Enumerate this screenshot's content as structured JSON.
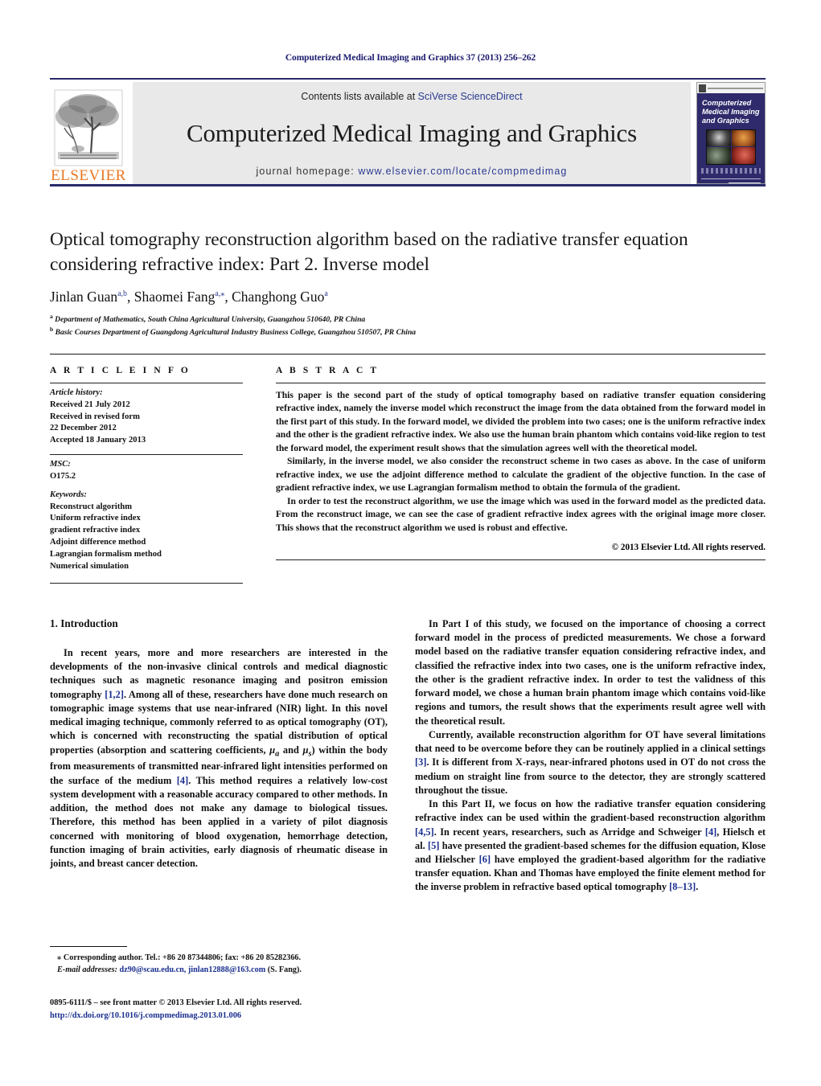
{
  "running_head": "Computerized Medical Imaging and Graphics 37 (2013) 256–262",
  "masthead": {
    "contents_prefix": "Contents lists available at ",
    "contents_link": "SciVerse ScienceDirect",
    "journal_title": "Computerized Medical Imaging and Graphics",
    "homepage_prefix": "journal homepage: ",
    "homepage_url": "www.elsevier.com/locate/compmedimag",
    "publisher": "ELSEVIER",
    "cover_title": "Computerized Medical Imaging and Graphics"
  },
  "article": {
    "title": "Optical tomography reconstruction algorithm based on the radiative transfer equation considering refractive index: Part 2. Inverse model",
    "authors": "Jinlan Guan, Shaomei Fang, Changhong Guo",
    "author_parts": [
      {
        "name": "Jinlan Guan",
        "sup": "a,b",
        "sep": ", "
      },
      {
        "name": "Shaomei Fang",
        "sup": "a,⁎",
        "sep": ", "
      },
      {
        "name": "Changhong Guo",
        "sup": "a",
        "sep": ""
      }
    ],
    "affiliations": [
      {
        "mark": "a",
        "text": "Department of Mathematics, South China Agricultural University, Guangzhou 510640, PR China"
      },
      {
        "mark": "b",
        "text": "Basic Courses Department of Guangdong Agricultural Industry Business College, Guangzhou 510507, PR China"
      }
    ]
  },
  "info": {
    "heading": "A R T I C L E   I N F O",
    "history_label": "Article history:",
    "history": [
      "Received 21 July 2012",
      "Received in revised form",
      "22 December 2012",
      "Accepted 18 January 2013"
    ],
    "msc_label": "MSC:",
    "msc_value": "O175.2",
    "keywords_label": "Keywords:",
    "keywords": [
      "Reconstruct algorithm",
      "Uniform refractive index",
      "gradient refractive index",
      "Adjoint difference method",
      "Lagrangian formalism method",
      "Numerical simulation"
    ]
  },
  "abstract": {
    "heading": "A B S T R A C T",
    "paragraphs": [
      "This paper is the second part of the study of optical tomography based on radiative transfer equation considering refractive index, namely the inverse model which reconstruct the image from the data obtained from the forward model in the first part of this study. In the forward model, we divided the problem into two cases; one is the uniform refractive index and the other is the gradient refractive index. We also use the human brain phantom which contains void-like region to test the forward model, the experiment result shows that the simulation agrees well with the theoretical model.",
      "Similarly, in the inverse model, we also consider the reconstruct scheme in two cases as above. In the case of uniform refractive index, we use the adjoint difference method to calculate the gradient of the objective function. In the case of gradient refractive index, we use Lagrangian formalism method to obtain the formula of the gradient.",
      "In order to test the reconstruct algorithm, we use the image which was used in the forward model as the predicted data. From the reconstruct image, we can see the case of gradient refractive index agrees with the original image more closer. This shows that the reconstruct algorithm we used is robust and effective."
    ],
    "copyright": "© 2013 Elsevier Ltd. All rights reserved."
  },
  "intro": {
    "heading": "1.  Introduction",
    "left_paragraphs": [
      "In recent years, more and more researchers are interested in the developments of the non-invasive clinical controls and medical diagnostic techniques such as magnetic resonance imaging and positron emission tomography [1,2]. Among all of these, researchers have done much research on tomographic image systems that use near-infrared (NIR) light. In this novel medical imaging technique, commonly referred to as optical tomography (OT), which is concerned with reconstructing the spatial distribution of optical properties (absorption and scattering coefficients, μa and μs) within the body from measurements of transmitted near-infrared light intensities performed on the surface of the medium [4]. This method requires a relatively low-cost system development with a reasonable accuracy compared to other methods. In addition, the method does not make any damage to biological tissues. Therefore, this method has been applied in a variety of pilot diagnosis concerned with monitoring of blood oxygenation, hemorrhage detection, function imaging of brain activities, early diagnosis of rheumatic disease in joints, and breast cancer detection."
    ],
    "right_paragraphs": [
      "In Part I of this study, we focused on the importance of choosing a correct forward model in the process of predicted measurements. We chose a forward model based on the radiative transfer equation considering refractive index, and classified the refractive index into two cases, one is the uniform refractive index, the other is the gradient refractive index. In order to test the validness of this forward model, we chose a human brain phantom image which contains void-like regions and tumors, the result shows that the experiments result agree well with the theoretical result.",
      "Currently, available reconstruction algorithm for OT have several limitations that need to be overcome before they can be routinely applied in a clinical settings [3]. It is different from X-rays, near-infrared photons used in OT do not cross the medium on straight line from source to the detector, they are strongly scattered throughout the tissue.",
      "In this Part II, we focus on how the radiative transfer equation considering refractive index can be used within the gradient-based reconstruction algorithm [4,5]. In recent years, researchers, such as Arridge and Schweiger [4], Hielsch et al. [5] have presented the gradient-based schemes for the diffusion equation, Klose and Hielscher [6] have employed the gradient-based algorithm for the radiative transfer equation. Khan and Thomas have employed the finite element method for the inverse problem in refractive based optical tomography [8–13]."
    ]
  },
  "footnotes": {
    "corresponding": "⁎  Corresponding author. Tel.: +86 20 87344806; fax: +86 20 85282366.",
    "email_label": "E-mail addresses:",
    "emails": "dz90@scau.edu.cn, jinlan12888@163.com",
    "email_suffix": " (S. Fang).",
    "issn_line": "0895-6111/$ – see front matter © 2013 Elsevier Ltd. All rights reserved.",
    "doi_line": "http://dx.doi.org/10.1016/j.compmedimag.2013.01.006"
  },
  "colors": {
    "link": "#1a2f8f",
    "header_navy": "#1a1a6e",
    "elsevier_orange": "#E87722",
    "masthead_band": "#e9e9e9",
    "cover_bg": "#2e2a6b"
  }
}
